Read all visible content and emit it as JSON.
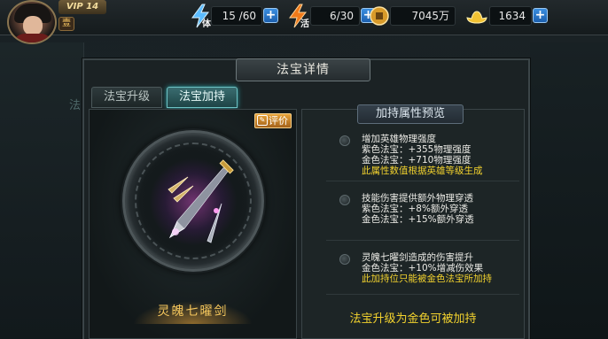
{
  "player": {
    "vip": "VIP 14",
    "rank_glyph": "壹"
  },
  "resources": {
    "stamina": {
      "tag": "体",
      "value": "15 /60"
    },
    "vigor": {
      "tag": "活",
      "value": "6/30"
    },
    "coins": {
      "value": "7045万"
    },
    "gold": {
      "value": "1634"
    },
    "plus_label": "+"
  },
  "background": {
    "ghost_text": "法"
  },
  "dialog": {
    "title": "法宝详情",
    "tabs": [
      {
        "label": "法宝升级",
        "active": false
      },
      {
        "label": "法宝加持",
        "active": true
      }
    ],
    "rate_button": "评价",
    "item_name": "灵魄七曜剑",
    "section_title": "加持属性预览",
    "bonuses": [
      {
        "lines": [
          {
            "text": "增加英雄物理强度",
            "color": "white"
          },
          {
            "text": "紫色法宝：+355物理强度",
            "color": "white"
          },
          {
            "text": "金色法宝：+710物理强度",
            "color": "white"
          },
          {
            "text": "此属性数值根据英雄等级生成",
            "color": "yellow"
          }
        ]
      },
      {
        "lines": [
          {
            "text": "技能伤害提供额外物理穿透",
            "color": "white"
          },
          {
            "text": "紫色法宝：+8%额外穿透",
            "color": "white"
          },
          {
            "text": "金色法宝：+15%额外穿透",
            "color": "white"
          }
        ]
      },
      {
        "lines": [
          {
            "text": "灵魄七曜剑造成的伤害提升",
            "color": "white"
          },
          {
            "text": "金色法宝：+10%增减伤效果",
            "color": "white"
          },
          {
            "text": "此加持位只能被金色法宝所加持",
            "color": "yellow"
          }
        ]
      }
    ],
    "footer_note": "法宝升级为金色可被加持"
  },
  "colors": {
    "accent_gold": "#f2d22e",
    "tab_active": "#6ec2c4",
    "plus_blue": "#2a78c8"
  }
}
